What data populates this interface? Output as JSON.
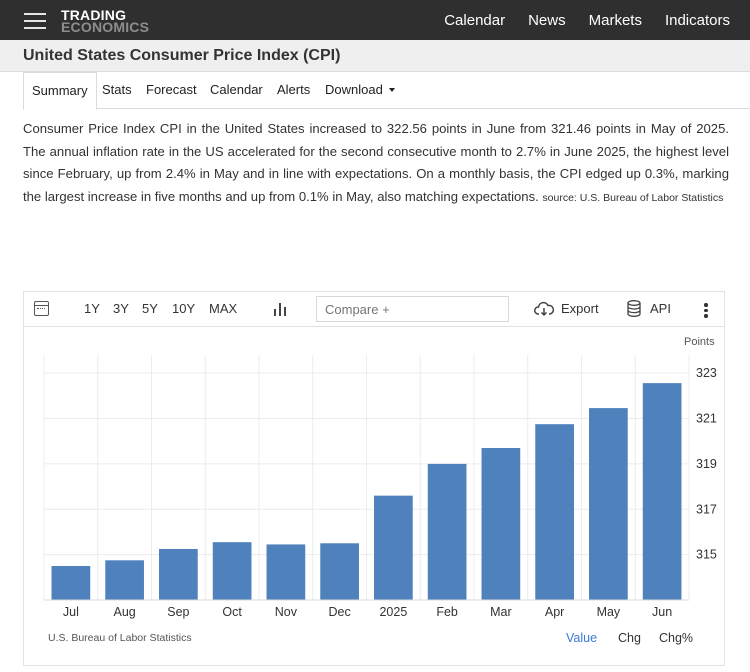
{
  "header": {
    "logo_line1": "TRADING",
    "logo_line2": "ECONOMICS",
    "nav": [
      "Calendar",
      "News",
      "Markets",
      "Indicators"
    ]
  },
  "page": {
    "title": "United States Consumer Price Index (CPI)"
  },
  "tabs": {
    "summary": "Summary",
    "stats": "Stats",
    "forecast": "Forecast",
    "calendar": "Calendar",
    "alerts": "Alerts",
    "download": "Download"
  },
  "summary": {
    "text": "Consumer Price Index CPI in the United States increased to 322.56 points in June from 321.46 points in May of 2025. The annual inflation rate in the US accelerated for the second consecutive month to 2.7% in June 2025, the highest level since February, up from 2.4% in May and in line with expectations. On a monthly basis, the CPI edged up 0.3%, marking the largest increase in five months and up from 0.1% in May, also matching expectations.",
    "source": "source: U.S. Bureau of Labor Statistics"
  },
  "toolbar": {
    "ranges": [
      "1Y",
      "3Y",
      "5Y",
      "10Y",
      "MAX"
    ],
    "compare_placeholder": "Compare +",
    "export": "Export",
    "api": "API"
  },
  "footer": {
    "source": "U.S. Bureau of Labor Statistics",
    "value": "Value",
    "chg": "Chg",
    "chg_pct": "Chg%"
  },
  "colors": {
    "bar": "#4f81bd",
    "active_link": "#3a7bd5",
    "topbar": "#2f2f2f"
  },
  "chart_data": {
    "type": "bar",
    "categories": [
      "Jul",
      "Aug",
      "Sep",
      "Oct",
      "Nov",
      "Dec",
      "2025",
      "Feb",
      "Mar",
      "Apr",
      "May",
      "Jun"
    ],
    "values": [
      314.5,
      314.75,
      315.25,
      315.55,
      315.45,
      315.5,
      317.6,
      319.0,
      319.7,
      320.75,
      321.46,
      322.56
    ],
    "unit_label": "Points",
    "yticks": [
      315,
      317,
      319,
      321,
      323
    ],
    "ylim": [
      313.0,
      323.8
    ],
    "grid": true,
    "title": ""
  }
}
